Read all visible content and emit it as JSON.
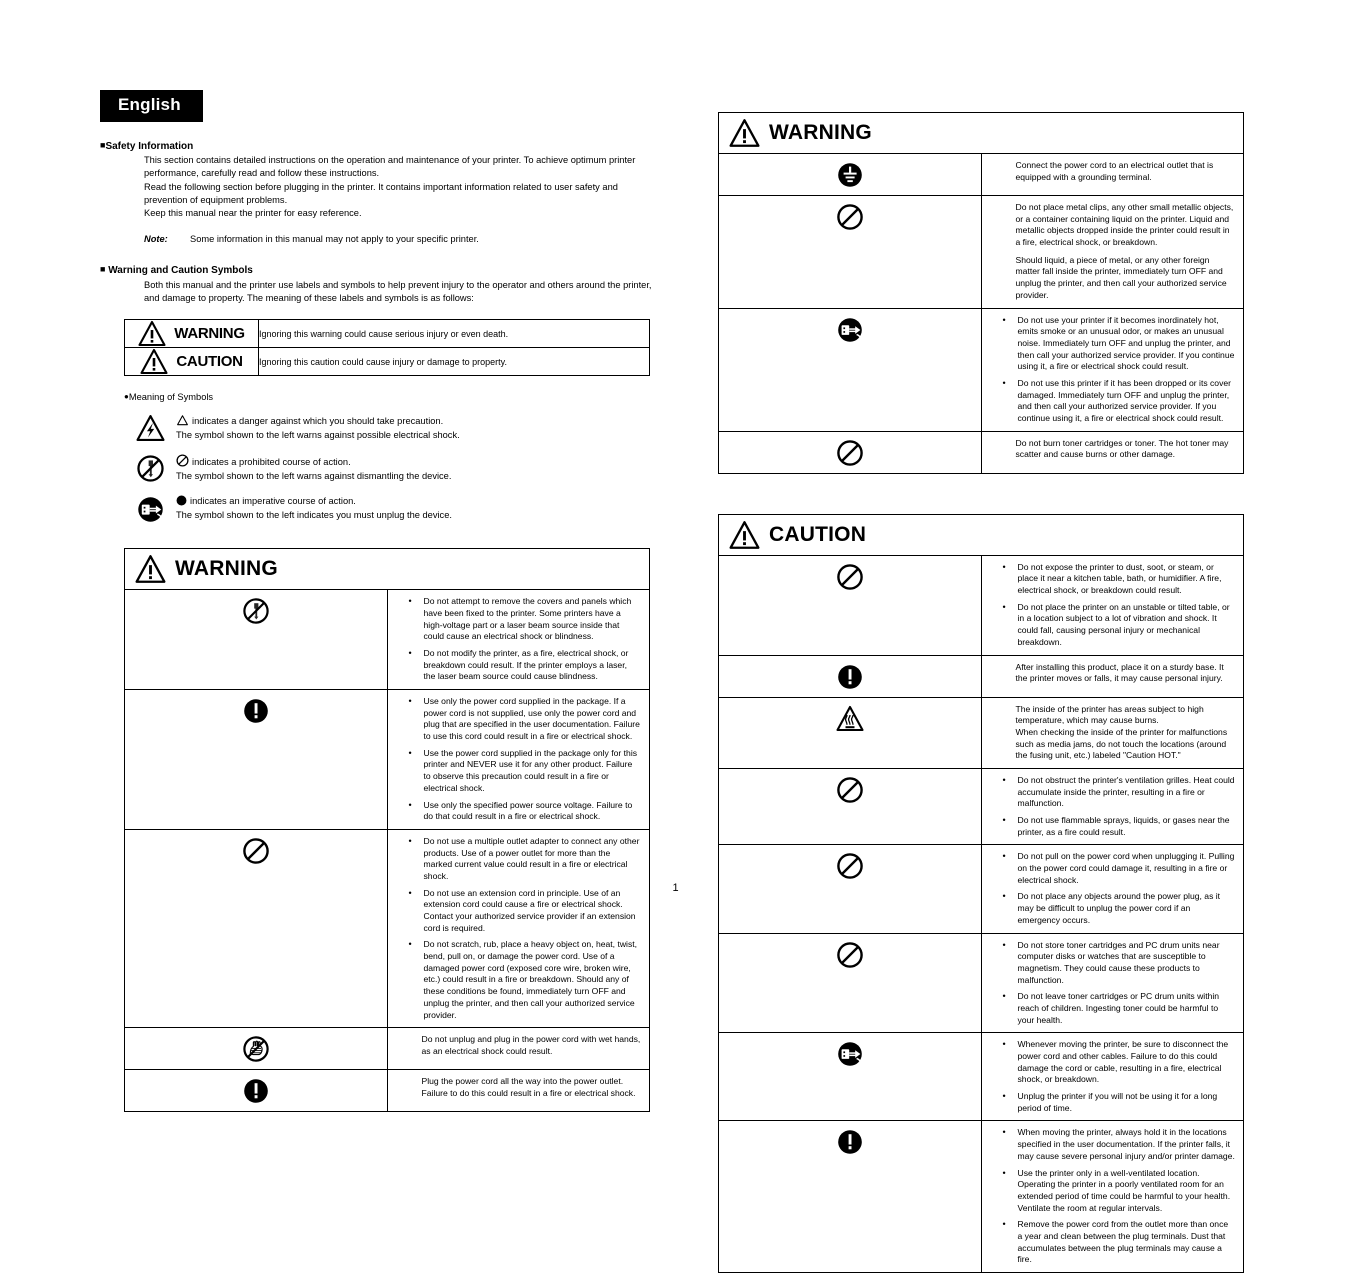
{
  "language_badge": "English",
  "page_number": "1",
  "safety_information": {
    "heading": "Safety Information",
    "paragraph1": "This section contains detailed instructions on the operation and maintenance of your printer. To achieve optimum printer performance, carefully read and follow these instructions.",
    "paragraph2": "Read the following section before plugging in the printer. It contains important information related to user safety and prevention of equipment problems.",
    "paragraph3": "Keep this manual near the printer for easy reference.",
    "note_label": "Note:",
    "note_text": "Some information in this manual may not apply to your specific printer."
  },
  "warning_and_caution_symbols": {
    "heading": "Warning and Caution Symbols",
    "intro": "Both this manual and the printer use labels and symbols to help prevent injury to the operator and others around the printer, and damage to property. The meaning of these labels and symbols is as follows:",
    "legend": [
      {
        "icon": "warning-triangle-icon",
        "label": "WARNING",
        "description": "Ignoring this warning could cause serious injury or even death."
      },
      {
        "icon": "warning-triangle-icon",
        "label": "CAUTION",
        "description": "Ignoring this caution could cause injury or damage to property."
      }
    ]
  },
  "meaning_of_symbols": {
    "title": "Meaning of Symbols",
    "rows": [
      {
        "icon": "electrical-shock-triangle-icon",
        "line1": "indicates a danger against which you should take precaution.",
        "line2": "The symbol shown to the left warns against possible electrical shock."
      },
      {
        "icon": "no-dismantle-prohibition-icon",
        "line1": "indicates a prohibited course of action.",
        "line2": "The symbol shown to the left warns against dismantling the device."
      },
      {
        "icon": "unplug-device-icon",
        "line1": "indicates an imperative course of action.",
        "line2": "The symbol shown to the left indicates you must unplug the device."
      }
    ]
  },
  "warning_table_left": {
    "title": "WARNING",
    "rows": [
      {
        "icon": "no-dismantle-prohibition-icon",
        "items": [
          "Do not attempt to remove the covers and panels which have been fixed to the printer. Some printers have a high-voltage part or a laser beam source inside that could cause an electrical shock or blindness.",
          "Do not modify the printer, as a fire, electrical shock, or breakdown could result. If the printer employs a laser, the laser beam source could cause blindness."
        ]
      },
      {
        "icon": "mandatory-exclamation-icon",
        "items": [
          "Use only the power cord supplied in the package. If a power cord is not supplied, use only the power cord and plug that are specified in the user documentation. Failure to use this cord could result in a fire or electrical shock.",
          "Use the power cord supplied in the package only for this printer and NEVER use it for any other product. Failure to observe this precaution could result in a fire or electrical shock.",
          "Use only the specified power source voltage. Failure to do that could result in a fire or electrical shock."
        ]
      },
      {
        "icon": "prohibition-circle-icon",
        "items": [
          "Do not use a multiple outlet adapter to connect any other products. Use of a power outlet for more than the marked current value could result in a fire or electrical shock.",
          "Do not use an extension cord in principle. Use of an extension cord could cause a fire or electrical shock. Contact your authorized service provider if an extension cord is required.",
          "Do not scratch, rub, place a heavy object on, heat, twist, bend, pull on, or damage the power cord. Use of a damaged power cord (exposed core wire, broken wire, etc.) could result in a fire or breakdown. Should any of these conditions be found, immediately turn OFF and unplug the printer, and then call your authorized service provider."
        ]
      },
      {
        "icon": "no-wet-hands-prohibition-icon",
        "paragraphs": [
          "Do not unplug and plug in the power cord with wet hands, as an electrical shock could result."
        ]
      },
      {
        "icon": "mandatory-exclamation-icon",
        "paragraphs": [
          "Plug the power cord all the way into the power outlet. Failure to do this could result in a fire or electrical shock."
        ]
      }
    ]
  },
  "warning_table_right": {
    "title": "WARNING",
    "rows": [
      {
        "icon": "grounding-terminal-icon",
        "paragraphs": [
          "Connect the power cord to an electrical outlet that is equipped with a grounding terminal."
        ]
      },
      {
        "icon": "prohibition-circle-icon",
        "paragraphs": [
          "Do not place metal clips, any other small metallic objects, or a container containing liquid on the printer. Liquid and metallic objects dropped inside the printer could result in a fire, electrical shock, or breakdown.",
          "Should liquid, a piece of metal, or any other foreign matter fall inside the printer, immediately turn OFF and unplug the printer, and then call your authorized service provider."
        ]
      },
      {
        "icon": "unplug-device-icon",
        "items": [
          "Do not use your printer if it becomes inordinately hot, emits smoke or an unusual odor, or makes an unusual noise. Immediately turn OFF and unplug the printer, and then call your authorized service provider. If you continue using it, a fire or electrical shock could result.",
          "Do not use this printer if it has been dropped or its cover damaged. Immediately turn OFF and unplug the printer, and then call your authorized service provider. If you continue using it, a fire or electrical shock could result."
        ]
      },
      {
        "icon": "prohibition-circle-icon",
        "paragraphs": [
          "Do not burn toner cartridges or toner. The hot toner may scatter and cause burns or other damage."
        ]
      }
    ]
  },
  "caution_table_right": {
    "title": "CAUTION",
    "rows": [
      {
        "icon": "prohibition-circle-icon",
        "items": [
          "Do not expose the printer to dust, soot, or steam, or place it near a kitchen table, bath, or humidifier. A fire, electrical shock, or breakdown could result.",
          "Do not place the printer on an unstable or tilted table, or in a location subject to a lot of vibration and shock. It could fall, causing personal injury or mechanical breakdown."
        ]
      },
      {
        "icon": "mandatory-exclamation-icon",
        "paragraphs": [
          "After installing this product, place it on a sturdy base. It the printer moves or falls, it may cause personal injury."
        ]
      },
      {
        "icon": "hot-surface-triangle-icon",
        "paragraphs": [
          "The inside of the printer has areas subject to high temperature, which may cause burns.",
          "When checking the inside of the printer for malfunctions such as media jams, do not touch the locations (around the fusing unit, etc.) labeled \"Caution HOT.\""
        ]
      },
      {
        "icon": "prohibition-circle-icon",
        "items": [
          "Do not obstruct the printer's ventilation grilles. Heat could accumulate inside the printer, resulting in a fire or malfunction.",
          "Do not use flammable sprays, liquids, or gases near the printer, as a fire could result."
        ]
      },
      {
        "icon": "prohibition-circle-icon",
        "items": [
          "Do not pull on the power cord when unplugging it. Pulling on the power cord could damage it, resulting in a fire or electrical shock.",
          "Do not place any objects around the power plug, as it may be difficult to unplug the power cord if an emergency occurs."
        ]
      },
      {
        "icon": "prohibition-circle-icon",
        "items": [
          "Do not store toner cartridges and PC drum units near computer disks or watches that are susceptible to magnetism. They could cause these products to malfunction.",
          "Do not leave toner cartridges or PC drum units within reach of children. Ingesting toner could be harmful to your health."
        ]
      },
      {
        "icon": "unplug-device-icon",
        "items": [
          "Whenever moving the printer, be sure to disconnect the power cord and other cables. Failure to do this could damage the cord or cable, resulting in a fire, electrical shock, or breakdown.",
          "Unplug the printer if you will not be using it for a long period of time."
        ]
      },
      {
        "icon": "mandatory-exclamation-icon",
        "items": [
          "When moving the printer, always hold it in the locations specified in the user documentation. If the printer falls, it may cause severe personal injury and/or printer damage.",
          "Use the printer only in a well-ventilated location. Operating the printer in a poorly ventilated room for an extended period of time could be harmful to your health. Ventilate the room at regular intervals.",
          "Remove the power cord from the outlet more than once a year and clean between the plug terminals. Dust that accumulates between the plug terminals may cause a fire."
        ]
      }
    ]
  },
  "colors": {
    "ink": "#000000",
    "paper": "#ffffff",
    "badge_bg": "#000000",
    "badge_text": "#ffffff"
  }
}
